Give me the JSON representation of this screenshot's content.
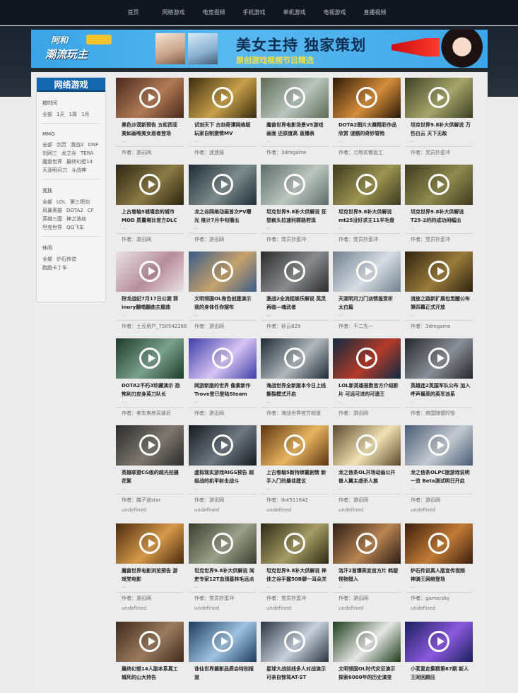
{
  "nav": [
    "首页",
    "网络游戏",
    "电竞视频",
    "手机游戏",
    "单机游戏",
    "电视游戏",
    "直播视频"
  ],
  "banner": {
    "logo_top": "阿和",
    "logo_bottom": "潮流玩主",
    "title": "美女主持 独家策划",
    "subtitle": "原创游戏视频节目精选"
  },
  "sidebar": {
    "title": "网络游戏",
    "sections": [
      {
        "head": "按时间",
        "items": [
          "全部",
          "1天",
          "1周",
          "1月"
        ]
      },
      {
        "head": "MMO",
        "items": [
          "全部",
          "剑灵",
          "激战2",
          "DNF",
          "剑网三",
          "龙之谷",
          "TERA",
          "魔兽世界",
          "最终幻想14",
          "天涯明月刀",
          "斗战神"
        ]
      },
      {
        "head": "竞技",
        "items": [
          "全部",
          "LOL",
          "第三把剑",
          "风暴英雄",
          "DOTA2",
          "CF",
          "英雄三国",
          "神之浩劫",
          "坦克世界",
          "QQ飞车"
        ]
      },
      {
        "head": "休闲",
        "items": [
          "全部",
          "炉石传说",
          "跑跑卡丁车"
        ]
      }
    ]
  },
  "author_prefix": "作者：",
  "cards": [
    {
      "title": "黑色沙漠新预告 五松西亚美如画唯美女恶者登场",
      "author": "游迅网",
      "extra": "",
      "c1": "#4a2a1f",
      "c2": "#b07a55"
    },
    {
      "title": "试剑天下 古剑奇谭网络版玩家自制激情MV",
      "author": "迷迷鼓",
      "extra": "",
      "c1": "#3a2c10",
      "c2": "#c7a04a"
    },
    {
      "title": "魔兽世界电影场景VS游戏画面 还原度高 直播表",
      "author": "3dmgame",
      "extra": "",
      "c1": "#5e6a55",
      "c2": "#b9c4bd"
    },
    {
      "title": "DOTA2图片大赛精彩作品欣赏 谜题的奇妙冒险",
      "author": "刀塔贰都运工",
      "extra": "",
      "c1": "#2b1a08",
      "c2": "#d58d3a"
    },
    {
      "title": "坦克世界9.8补大供解说 万伤白云 天下无敌",
      "author": "党员抄歪冲",
      "extra": "",
      "c1": "#3b4023",
      "c2": "#a6a56b"
    },
    {
      "title": "上古卷轴5城墙恋的城市MOD 质量堪比官方DLC",
      "author": "游迅网",
      "extra": "",
      "c1": "#2b2512",
      "c2": "#8b7a45"
    },
    {
      "title": "龙之谷网络动画首次PV曝光 推计7月中旬播出",
      "author": "游迅网",
      "extra": "",
      "c1": "#1f2b33",
      "c2": "#7d8c8e"
    },
    {
      "title": "坦克世界9.8补大供解说 狂怒疯头拉速利郡路若现",
      "author": "党员抄歪冲",
      "extra": "",
      "c1": "#5d6b68",
      "c2": "#bcc6c0"
    },
    {
      "title": "坦克世界9.8补大供解说 mt25没好求主11羊毛盘",
      "author": "党员抄歪冲",
      "extra": "",
      "c1": "#3b3a20",
      "c2": "#9c9450"
    },
    {
      "title": "坦克世界9.8补大供解说 T25-2的的成功闲幅出",
      "author": "党员抄歪冲",
      "extra": "",
      "c1": "#3e3a1f",
      "c2": "#8e8a4f"
    },
    {
      "title": "狩龙战纪7月17日公测 郭inory翻唱翻曲主题曲",
      "author": "土豆用户_750542266",
      "extra": "",
      "c1": "#e9e2e4",
      "c2": "#b68d9b"
    },
    {
      "title": "文明领国OL角色创建演示 我的身体任你摆布",
      "author": "游迅网",
      "extra": "",
      "c1": "#3b5c86",
      "c2": "#c6a26c"
    },
    {
      "title": "激战2全流程娱乐解说 英灵再临—魂武者",
      "author": "砂云829",
      "extra": "",
      "c1": "#2a2a2a",
      "c2": "#8a8b8e"
    },
    {
      "title": "天涯明月刀门派情报赏析 太白篇",
      "author": "不二先一",
      "extra": "",
      "c1": "#6f7f8e",
      "c2": "#d8dde3"
    },
    {
      "title": "流放之路新扩展包觉醒公布 第四幕正式开放",
      "author": "3dmgame",
      "extra": "",
      "c1": "#2d2212",
      "c2": "#9a7c3b"
    },
    {
      "title": "DOTA2不朽3珍藏演示 恐怖利刃皮身英刀队长",
      "author": "卖车卖房买装尼",
      "extra": "",
      "c1": "#1e3a2a",
      "c2": "#7ba08e"
    },
    {
      "title": "网游新版的世界 像素新作Trove登已登陆Steam",
      "author": "游迅网",
      "extra": "",
      "c1": "#3e3da8",
      "c2": "#d7c4f2"
    },
    {
      "title": "海战世界全新版本今日上线 撕裂模式开启",
      "author": "海战世界官方频道",
      "extra": "",
      "c1": "#1f2a33",
      "c2": "#b1b8bd"
    },
    {
      "title": "LOL新英雄报数官方介绍影片 可远可进的可遗王",
      "author": "游迅网",
      "extra": "",
      "c1": "#0f2a3f",
      "c2": "#b33a2a"
    },
    {
      "title": "英雄连2英国军队公布 加入呼声最高的英军派系",
      "author": "帝国随便的恰",
      "extra": "",
      "c1": "#24262a",
      "c2": "#8a8e96"
    },
    {
      "title": "英雄联盟CG级的超光拍摄花絮",
      "author": "踹子道star",
      "extra": "undefined",
      "c1": "#2a2b2e",
      "c2": "#7e776e"
    },
    {
      "title": "虚拟现实游戏RIGS预告 超级战的机甲射击战斗",
      "author": "游迅网",
      "extra": "undefined",
      "c1": "#161a1f",
      "c2": "#6e7880"
    },
    {
      "title": "上古卷轴5新持绑置剧情 新手入门的最佳建议",
      "author": "tk4511642",
      "extra": "undefined",
      "c1": "#5a3410",
      "c2": "#e8b560"
    },
    {
      "title": "龙之信条OL开场动画公开 普人翼主虐杀人族",
      "author": "游迅网",
      "extra": "undefined",
      "c1": "#5c4a2e",
      "c2": "#f0e2b4"
    },
    {
      "title": "龙之信条OLPC版游戏说明一览 Beta测试明日开启",
      "author": "游迅网",
      "extra": "undefined",
      "c1": "#4a5b75",
      "c2": "#c3c9cf"
    },
    {
      "title": "魔兽世界电影浏览预告 游戏党电影",
      "author": "游迅网",
      "extra": "undefined",
      "c1": "#4a2a10",
      "c2": "#d69a4a"
    },
    {
      "title": "坦克世界9.8补大供解说 闻吏专家12T血颈基林毛远点",
      "author": "党员抄歪冲",
      "extra": "undefined",
      "c1": "#3a3d2e",
      "c2": "#9aa08a"
    },
    {
      "title": "坦克世界9.8补大供解说 神佳之谷手握50B聊一耳朵关自",
      "author": "党员抄歪冲",
      "extra": "undefined",
      "c1": "#2c2a15",
      "c2": "#a59c66"
    },
    {
      "title": "洛汗2首爆高变官方片 韩版怪物猎人",
      "author": "游迅网",
      "extra": "undefined",
      "c1": "#2b1d16",
      "c2": "#b88452"
    },
    {
      "title": "炉石传说真人版宣传视频 神骑王网络登场",
      "author": "gamersky",
      "extra": "undefined",
      "c1": "#3a1f10",
      "c2": "#c27b35"
    },
    {
      "title": "最终幻想14人副本系真工城死的山大持告",
      "author": "",
      "extra": "",
      "c1": "#3e2a1e",
      "c2": "#9a7b5e"
    },
    {
      "title": "诛仙世界摄影品质会特别报道",
      "author": "",
      "extra": "",
      "c1": "#1e3a5e",
      "c2": "#9ec3e0"
    },
    {
      "title": "星球大战前线多人对战演示 可亲自惊驾AT-ST",
      "author": "",
      "extra": "",
      "c1": "#2a3542",
      "c2": "#c8d2dc"
    },
    {
      "title": "文明领国OL时代灾证演示 探索6000年的历史演变",
      "author": "",
      "extra": "",
      "c1": "#1f3d1c",
      "c2": "#e6e6e6"
    },
    {
      "title": "小茗复走集精第67期 新人王同回顾压",
      "author": "",
      "extra": "",
      "c1": "#1a1f5a",
      "c2": "#8b5ae0"
    }
  ]
}
